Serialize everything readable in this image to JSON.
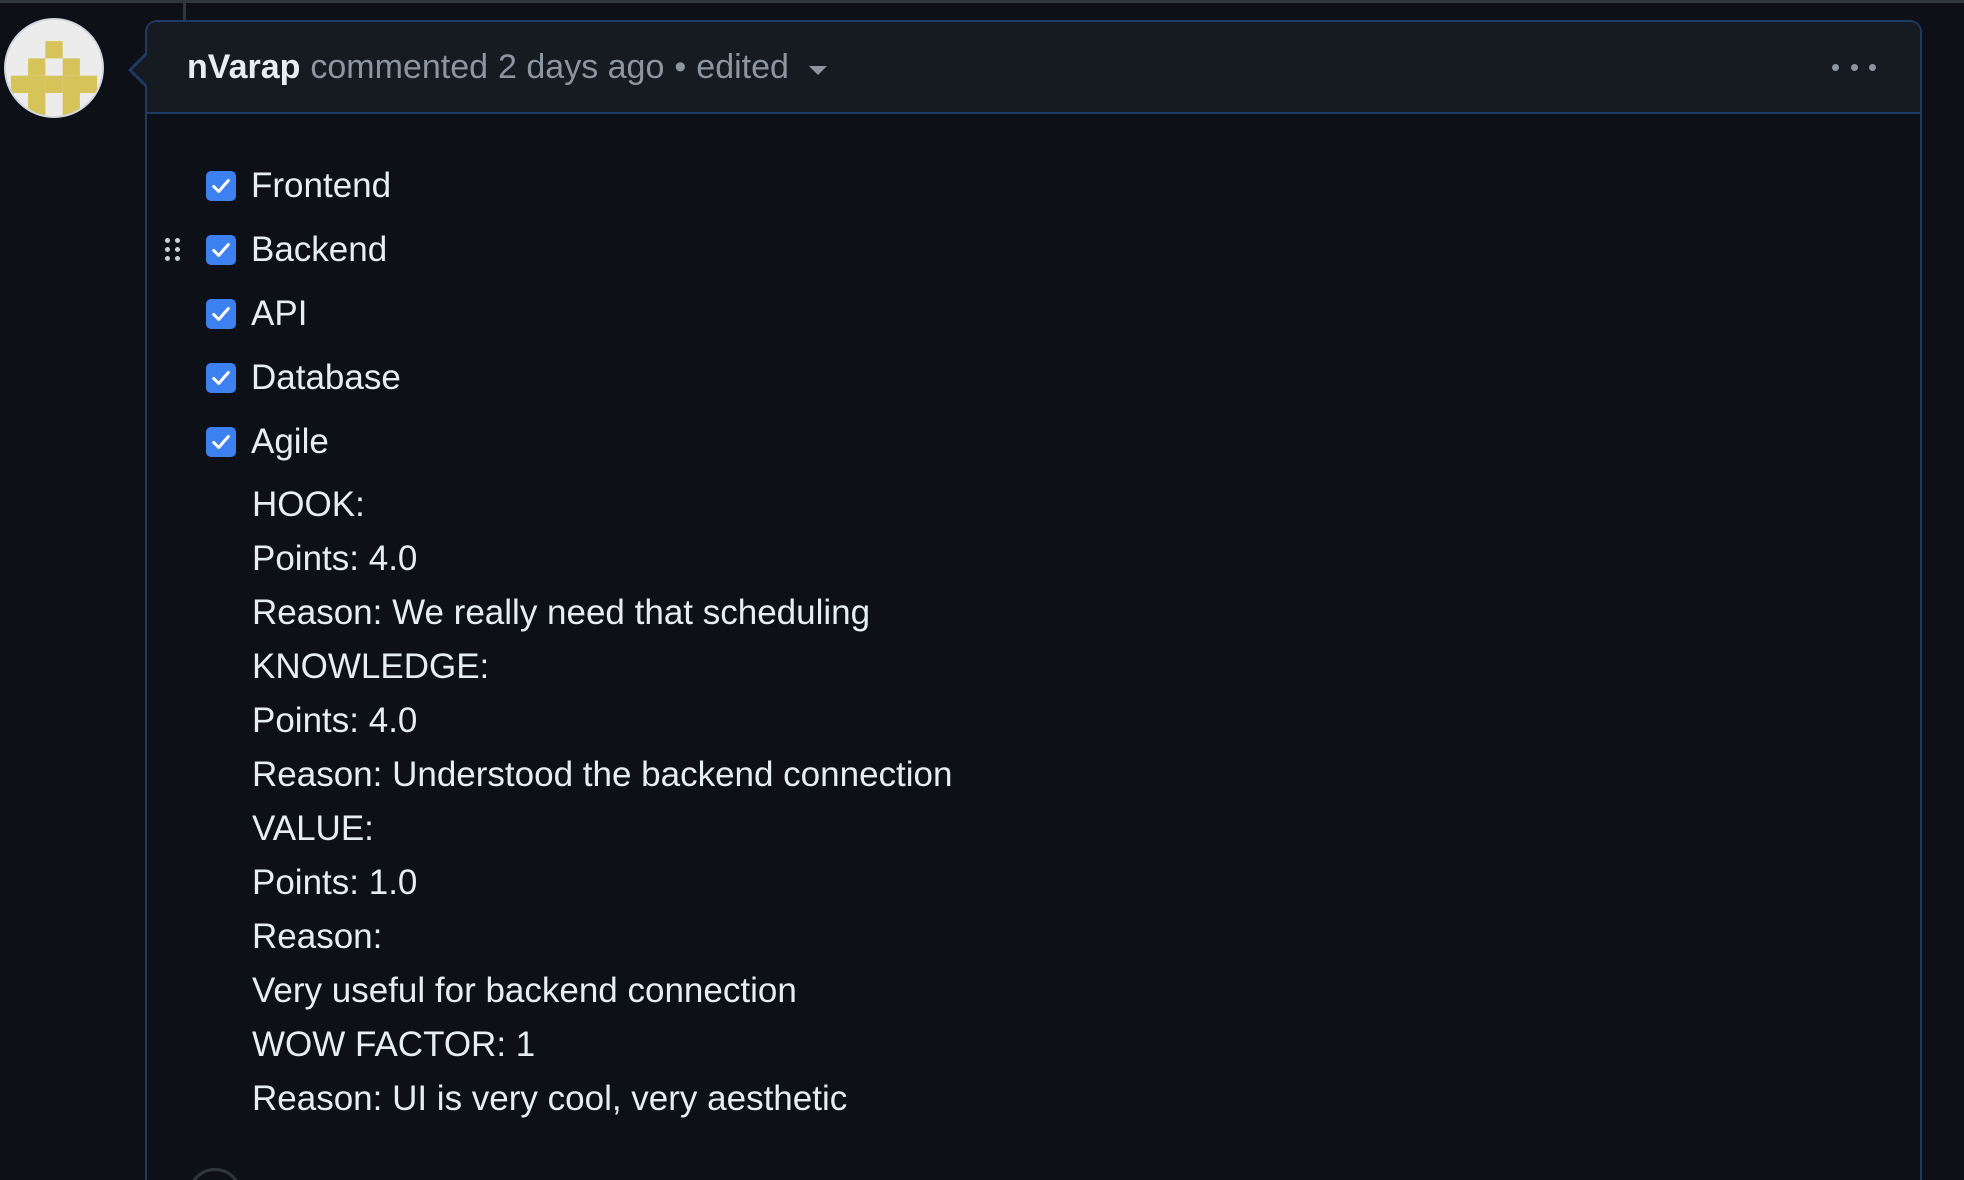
{
  "comment": {
    "author": "nVarap",
    "action": "commented",
    "time": "2 days ago",
    "separator": "•",
    "edited_label": "edited"
  },
  "tasks": [
    {
      "label": "Frontend",
      "checked": true
    },
    {
      "label": "Backend",
      "checked": true
    },
    {
      "label": "API",
      "checked": true
    },
    {
      "label": "Database",
      "checked": true
    },
    {
      "label": "Agile",
      "checked": true
    }
  ],
  "notes": [
    "HOOK:",
    "Points: 4.0",
    "Reason: We really need that scheduling",
    "KNOWLEDGE:",
    "Points: 4.0",
    "Reason: Understood the backend connection",
    "VALUE:",
    "Points: 1.0",
    "Reason:",
    "Very useful for backend connection",
    "WOW FACTOR: 1",
    "Reason: UI is very cool, very aesthetic"
  ],
  "colors": {
    "background": "#0d1117",
    "header_background": "#161b22",
    "border_accent": "#1f3a63",
    "checkbox_blue": "#3d80f0",
    "muted_text": "#8d96a0",
    "avatar_yellow": "#d6c45a"
  },
  "icons": {
    "avatar": "identicon",
    "menu": "kebab-horizontal-icon",
    "drag": "grabber-icon",
    "check": "check-icon",
    "dropdown": "triangle-down-icon"
  }
}
